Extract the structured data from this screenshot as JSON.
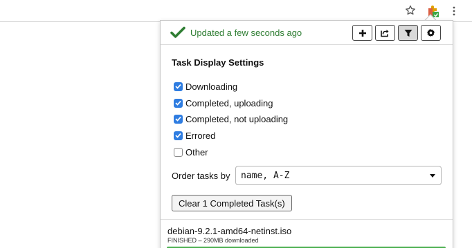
{
  "browser": {
    "bookmark_icon": "star-icon",
    "extension_icon": "puzzle-extension-icon",
    "menu_icon": "kebab-menu-icon"
  },
  "popup": {
    "status": {
      "icon": "checkmark-icon",
      "text": "Updated a few seconds ago",
      "color": "#2e7d32"
    },
    "toolbar_buttons": [
      {
        "name": "add",
        "icon": "plus-icon"
      },
      {
        "name": "open-external",
        "icon": "share-icon"
      },
      {
        "name": "filter",
        "icon": "filter-icon",
        "active": true
      },
      {
        "name": "settings",
        "icon": "gear-icon"
      }
    ],
    "settings": {
      "title": "Task Display Settings",
      "options": [
        {
          "label": "Downloading",
          "checked": true
        },
        {
          "label": "Completed, uploading",
          "checked": true
        },
        {
          "label": "Completed, not uploading",
          "checked": true
        },
        {
          "label": "Errored",
          "checked": true
        },
        {
          "label": "Other",
          "checked": false
        }
      ],
      "order_label": "Order tasks by",
      "order_value": "name, A-Z",
      "clear_button": "Clear 1 Completed Task(s)"
    },
    "task": {
      "name": "debian-9.2.1-amd64-netinst.iso",
      "status": "FINISHED – 290MB downloaded",
      "progress": 1.0,
      "progress_color": "#4caf50"
    },
    "accent_color": "#2f7de1"
  }
}
